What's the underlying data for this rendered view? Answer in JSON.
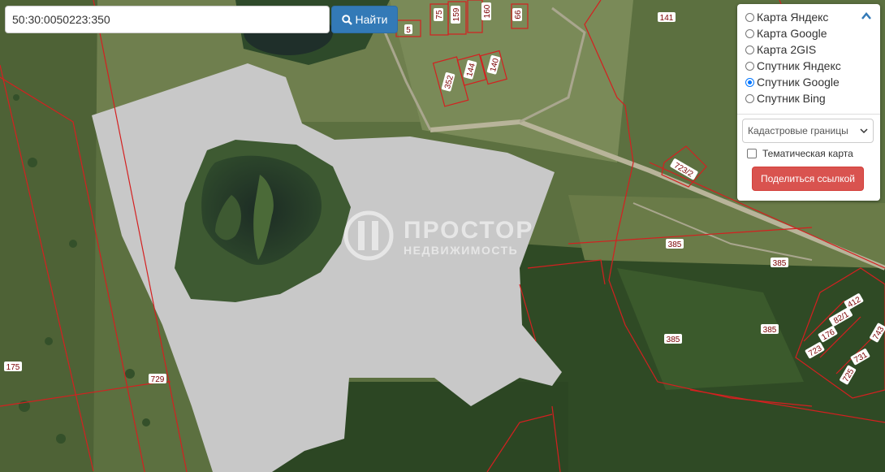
{
  "search": {
    "value": "50:30:0050223:350",
    "button_label": "Найти"
  },
  "layers": [
    {
      "label": "Карта Яндекс",
      "selected": false
    },
    {
      "label": "Карта Google",
      "selected": false
    },
    {
      "label": "Карта 2GIS",
      "selected": false
    },
    {
      "label": "Спутник Яндекс",
      "selected": false
    },
    {
      "label": "Спутник Google",
      "selected": true
    },
    {
      "label": "Спутник Bing",
      "selected": false
    }
  ],
  "overlay_select": "Кадастровые границы",
  "thematic_label": "Тематическая карта",
  "share_label": "Поделиться ссылкой",
  "watermark": {
    "line1": "ПРОСТОР",
    "line2": "НЕДВИЖИМОСТЬ"
  },
  "parcel_labels": [
    "5",
    "75",
    "159",
    "160",
    "66",
    "141",
    "352",
    "144",
    "140",
    "723/2",
    "385",
    "385",
    "385",
    "385",
    "412",
    "82/1",
    "176",
    "723",
    "731",
    "725",
    "743",
    "175",
    "729"
  ],
  "colors": {
    "boundary": "#d42020",
    "highlight": "#c8c8c8",
    "button_blue": "#337ab7",
    "button_red": "#d9534f"
  }
}
